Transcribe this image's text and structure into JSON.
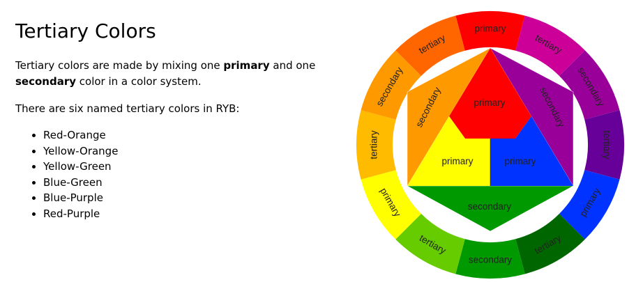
{
  "title": "Tertiary Colors",
  "intro": {
    "before": "Tertiary colors are made by mixing one ",
    "term1": "primary",
    "middle": " and one ",
    "term2": "secondary",
    "after": " color in a color system."
  },
  "lead": "There are six named tertiary colors in RYB:",
  "tertiary_colors": [
    "Red-Orange",
    "Yellow-Orange",
    "Yellow-Green",
    "Blue-Green",
    "Blue-Purple",
    "Red-Purple"
  ],
  "wheel": {
    "ring": [
      {
        "label": "primary",
        "color": "#ff0000"
      },
      {
        "label": "tertiary",
        "color": "#cc0099"
      },
      {
        "label": "secondary",
        "color": "#990099"
      },
      {
        "label": "tertiary",
        "color": "#660099"
      },
      {
        "label": "primary",
        "color": "#0033ff"
      },
      {
        "label": "tertiary",
        "color": "#006600"
      },
      {
        "label": "secondary",
        "color": "#009900"
      },
      {
        "label": "tertiary",
        "color": "#66cc00"
      },
      {
        "label": "primary",
        "color": "#ffff00"
      },
      {
        "label": "tertiary",
        "color": "#ffbb00"
      },
      {
        "label": "secondary",
        "color": "#ff9900"
      },
      {
        "label": "tertiary",
        "color": "#ff6600"
      }
    ],
    "center": {
      "red": {
        "label": "primary",
        "color": "#ff0000"
      },
      "yellow": {
        "label": "primary",
        "color": "#ffff00"
      },
      "blue": {
        "label": "primary",
        "color": "#0033ff"
      },
      "orange": {
        "label": "secondary",
        "color": "#ff9900"
      },
      "purple": {
        "label": "secondary",
        "color": "#990099"
      },
      "green": {
        "label": "secondary",
        "color": "#009900"
      }
    }
  }
}
